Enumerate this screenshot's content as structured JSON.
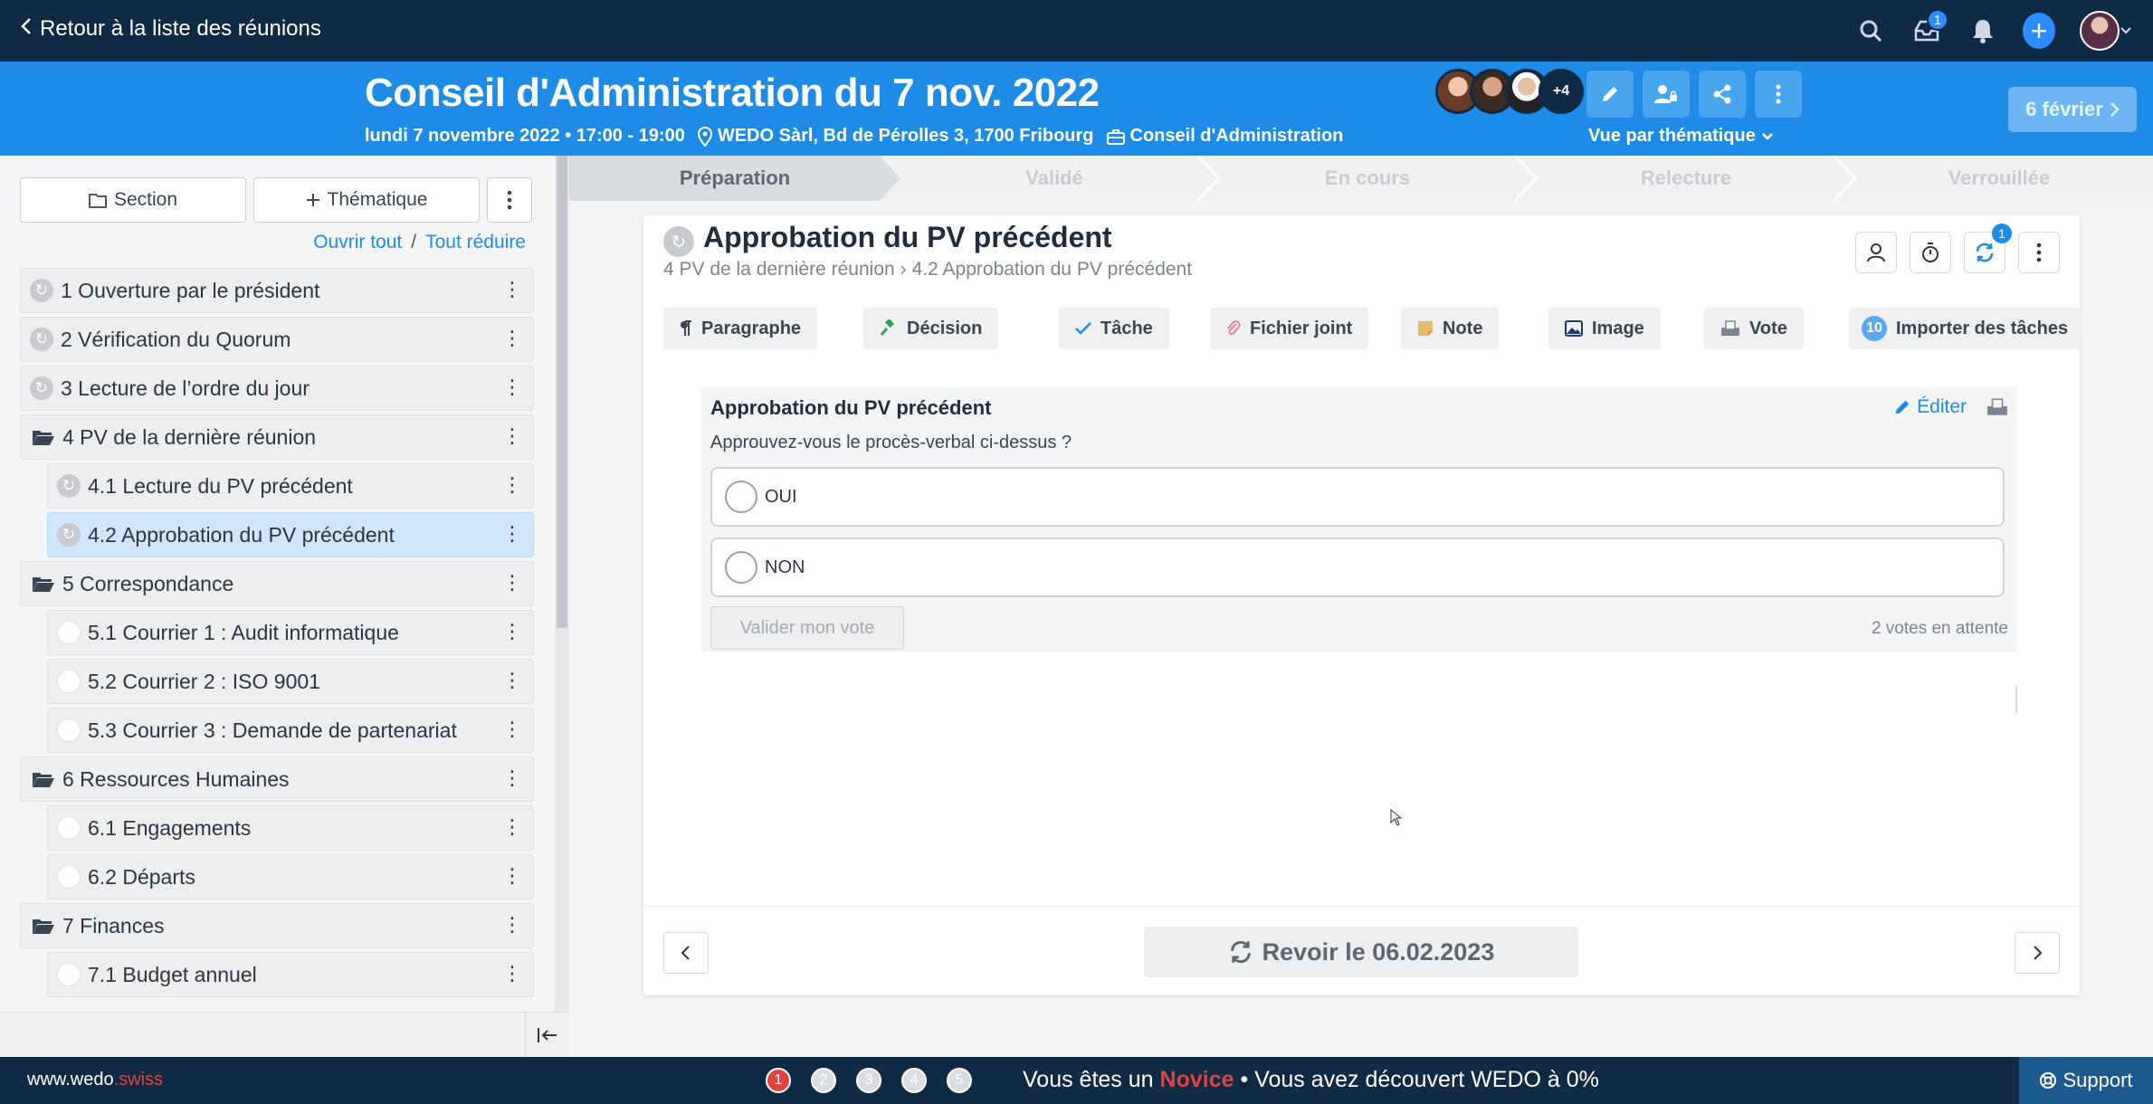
{
  "topbar": {
    "back_label": "Retour à la liste des réunions",
    "notification_count": "1",
    "icons": [
      "search-icon",
      "inbox-icon",
      "bell-icon",
      "plus-icon",
      "user-avatar"
    ]
  },
  "meeting": {
    "title": "Conseil d'Administration du 7 nov. 2022",
    "datetime": "lundi 7 novembre 2022 • 17:00 - 19:00",
    "location": "WEDO Sàrl, Bd de Pérolles 3, 1700 Fribourg",
    "board": "Conseil d'Administration",
    "participants_more": "+4",
    "view_mode": "Vue par thématique",
    "next_meeting": "6 février"
  },
  "sidebar": {
    "section_label": "Section",
    "theme_label": "Thématique",
    "expand_all": "Ouvrir tout",
    "separator": "/",
    "collapse_all": "Tout réduire",
    "items": [
      {
        "label": "1 Ouverture par le président",
        "icon": "sync"
      },
      {
        "label": "2 Vérification du Quorum",
        "icon": "sync"
      },
      {
        "label": "3 Lecture de l’ordre du jour",
        "icon": "sync"
      },
      {
        "label": "4 PV de la dernière réunion",
        "icon": "folder"
      },
      {
        "label": "4.1 Lecture du PV précédent",
        "icon": "sync"
      },
      {
        "label": "4.2 Approbation du PV précédent",
        "icon": "sync"
      },
      {
        "label": "5 Correspondance",
        "icon": "folder"
      },
      {
        "label": "5.1 Courrier 1 : Audit informatique",
        "icon": "empty"
      },
      {
        "label": "5.2 Courrier 2 : ISO 9001",
        "icon": "empty"
      },
      {
        "label": "5.3 Courrier 3 : Demande de partenariat",
        "icon": "empty"
      },
      {
        "label": "6 Ressources Humaines",
        "icon": "folder"
      },
      {
        "label": "6.1 Engagements",
        "icon": "empty"
      },
      {
        "label": "6.2 Départs",
        "icon": "empty"
      },
      {
        "label": "7 Finances",
        "icon": "folder"
      },
      {
        "label": "7.1 Budget annuel",
        "icon": "empty"
      }
    ]
  },
  "steps": [
    "Préparation",
    "Validé",
    "En cours",
    "Relecture",
    "Verrouillée"
  ],
  "topic": {
    "title": "Approbation du PV précédent",
    "crumb_parent": "4 PV de la dernière réunion",
    "crumb_sep": "›",
    "crumb_current": "4.2 Approbation du PV précédent",
    "sync_badge": "1"
  },
  "add_buttons": {
    "paragraph": "Paragraphe",
    "decision": "Décision",
    "task": "Tâche",
    "attachment": "Fichier joint",
    "note": "Note",
    "image": "Image",
    "vote": "Vote",
    "import_count": "10",
    "import_tasks": "Importer des tâches"
  },
  "vote": {
    "title": "Approbation du PV précédent",
    "edit_label": "Éditer",
    "question": "Approuvez-vous le procès-verbal ci-dessus ?",
    "options": [
      "OUI",
      "NON"
    ],
    "submit_label": "Valider mon vote",
    "pending": "2 votes en attente"
  },
  "footer": {
    "review_label": "Revoir le 06.02.2023"
  },
  "bottombar": {
    "site_prefix": "www.wedo",
    "site_suffix": ".swiss",
    "steps": [
      "1",
      "2",
      "3",
      "4",
      "5"
    ],
    "text_before": "Vous êtes un ",
    "level": "Novice",
    "text_after": " • Vous avez découvert WEDO à 0%",
    "support": "Support"
  },
  "colors": {
    "topbar": "#0f2a44",
    "header": "#1e8be6",
    "accent": "#1e8be6",
    "danger": "#e0443f"
  }
}
